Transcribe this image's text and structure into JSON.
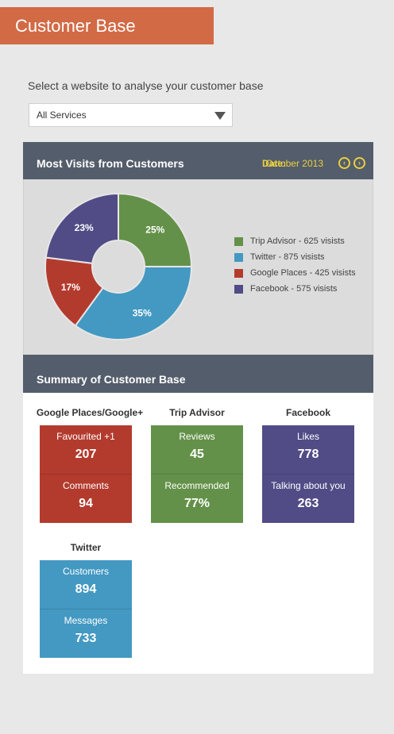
{
  "header": {
    "title": "Customer Base"
  },
  "selector": {
    "label": "Select a website to analyse your customer base",
    "value": "All Services"
  },
  "visits_panel": {
    "title": "Most Visits from Customers",
    "date_label": "Date:",
    "date_value": "October 2013",
    "prev_icon": "chevron-left-icon",
    "next_icon": "chevron-right-icon"
  },
  "chart_data": {
    "type": "pie",
    "categories": [
      "Trip Advisor",
      "Twitter",
      "Google Places",
      "Facebook"
    ],
    "values": [
      25,
      35,
      17,
      23
    ],
    "labels": [
      "25%",
      "35%",
      "17%",
      "23%"
    ],
    "colors": [
      "#649149",
      "#4399c2",
      "#b33b2e",
      "#514c86"
    ],
    "legend": [
      "Trip Advisor - 625 visists",
      "Twitter - 875 visists",
      "Google Places - 425 visists",
      "Facebook - 575 visists"
    ],
    "legend_position": "right"
  },
  "summary": {
    "title": "Summary of Customer Base",
    "groups": [
      {
        "name": "Google Places/Google+",
        "color": "#b33b2e",
        "metrics": [
          {
            "label": "Favourited +1",
            "value": "207"
          },
          {
            "label": "Comments",
            "value": "94"
          }
        ]
      },
      {
        "name": "Trip Advisor",
        "color": "#649149",
        "metrics": [
          {
            "label": "Reviews",
            "value": "45"
          },
          {
            "label": "Recommended",
            "value": "77%"
          }
        ]
      },
      {
        "name": "Facebook",
        "color": "#514c86",
        "metrics": [
          {
            "label": "Likes",
            "value": "778"
          },
          {
            "label": "Talking about you",
            "value": "263"
          }
        ]
      },
      {
        "name": "Twitter",
        "color": "#4399c2",
        "metrics": [
          {
            "label": "Customers",
            "value": "894"
          },
          {
            "label": "Messages",
            "value": "733"
          }
        ]
      }
    ]
  }
}
